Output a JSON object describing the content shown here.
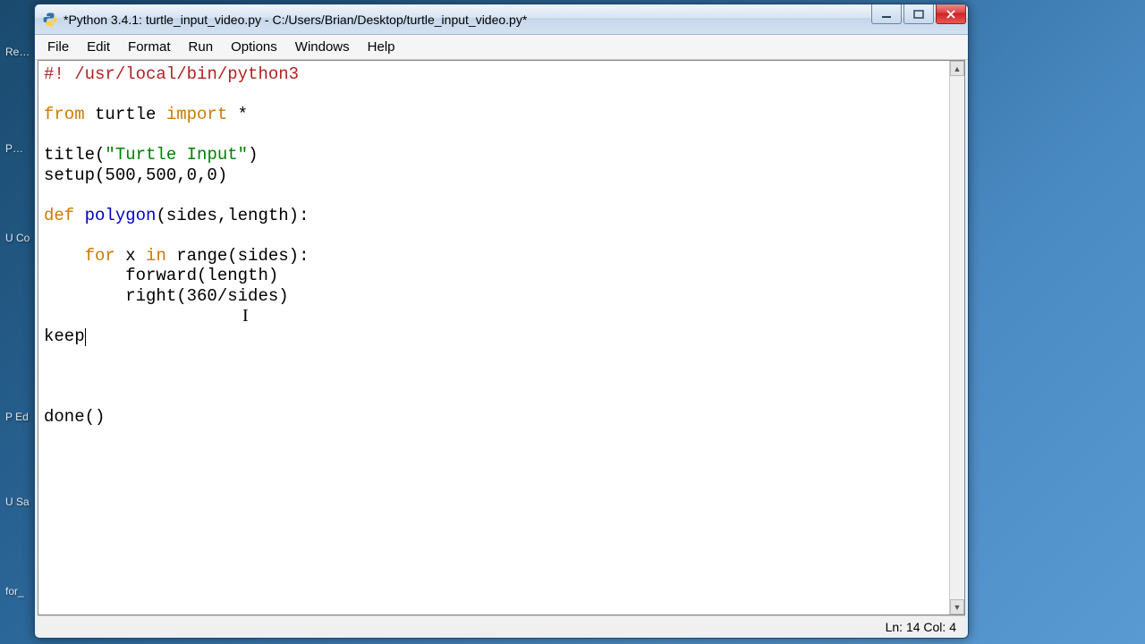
{
  "desktop": {
    "icons": [
      "Re…",
      "P…",
      "U\nCo",
      "P\nEd",
      "U\nSa",
      "for_"
    ]
  },
  "window": {
    "title": "*Python 3.4.1: turtle_input_video.py - C:/Users/Brian/Desktop/turtle_input_video.py*"
  },
  "menu": {
    "file": "File",
    "edit": "Edit",
    "format": "Format",
    "run": "Run",
    "options": "Options",
    "windows": "Windows",
    "help": "Help"
  },
  "code": {
    "shebang_pre": "#! ",
    "shebang_path": "/usr/local/bin/python3",
    "from_kw": "from",
    "import_mod": " turtle ",
    "import_kw": "import",
    "import_star": " *",
    "title_call_a": "title(",
    "title_str": "\"Turtle Input\"",
    "title_call_b": ")",
    "setup_call": "setup(500,500,0,0)",
    "def_kw": "def",
    "def_name": " polygon",
    "def_sig": "(sides,length):",
    "for_indent": "    ",
    "for_kw": "for",
    "for_var": " x ",
    "in_kw": "in",
    "range_call": " range(sides):",
    "body_indent": "        ",
    "fwd": "forward(length)",
    "right": "right(360/sides)",
    "keep": "keep",
    "done": "done()"
  },
  "status": {
    "ln_label": "Ln: ",
    "ln_val": "14",
    "col_label": " Col: ",
    "col_val": "4"
  }
}
